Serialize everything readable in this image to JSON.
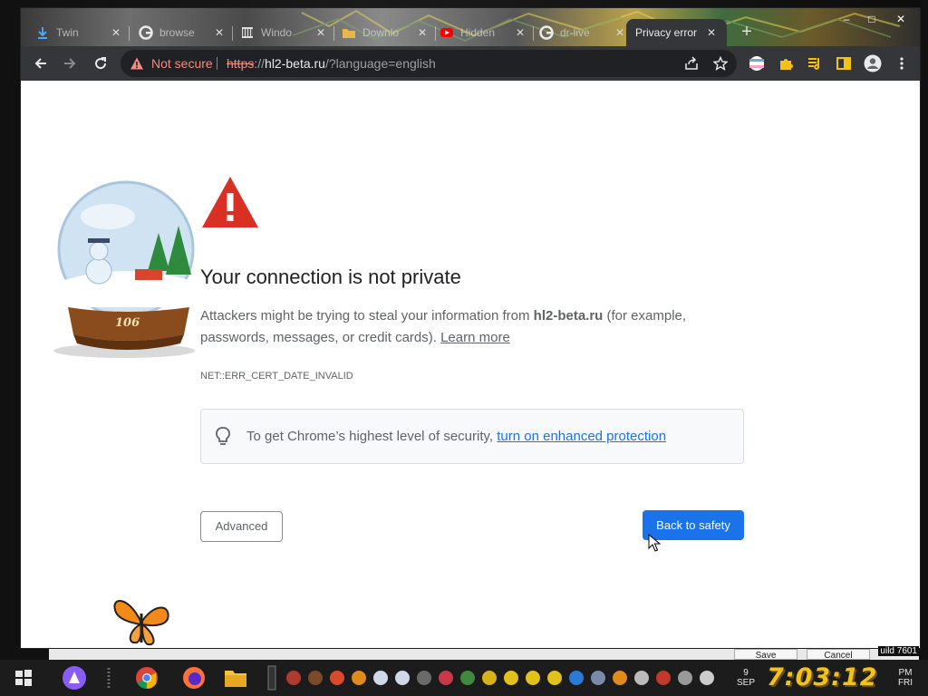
{
  "browser": {
    "tabs": [
      {
        "title": "Twin",
        "icon": "download-icon",
        "active": false
      },
      {
        "title": "browse",
        "icon": "google-icon",
        "active": false
      },
      {
        "title": "Windo",
        "icon": "archive-icon",
        "active": false
      },
      {
        "title": "Downlo",
        "icon": "folder-icon",
        "active": false
      },
      {
        "title": "Hidden",
        "icon": "youtube-icon",
        "active": false
      },
      {
        "title": "dr-live",
        "icon": "google-icon",
        "active": false
      },
      {
        "title": "Privacy error",
        "icon": "none",
        "active": true
      }
    ],
    "new_tab": "+",
    "window_controls": {
      "minimize": "–",
      "maximize": "□",
      "close": "✕"
    },
    "address": {
      "security_label": "Not secure",
      "url_scheme": "https",
      "url_sep": "://",
      "url_host": "hl2-beta.ru",
      "url_path": "/?language=english"
    }
  },
  "page": {
    "heading": "Your connection is not private",
    "message_prefix": "Attackers might be trying to steal your information from ",
    "message_host": "hl2-beta.ru",
    "message_suffix": " (for example, passwords, messages, or credit cards). ",
    "learn_more": "Learn more",
    "error_code": "NET::ERR_CERT_DATE_INVALID",
    "security_tip_prefix": "To get Chrome’s highest level of security, ",
    "security_tip_link": "turn on enhanced protection",
    "advanced_button": "Advanced",
    "back_button": "Back to safety",
    "snow_globe_label": "106"
  },
  "background_window": {
    "save": "Save",
    "cancel": "Cancel",
    "build": "uild 7601"
  },
  "taskbar": {
    "date_day": "9",
    "date_month": "SEP",
    "time": "7:03:12",
    "ampm": "PM",
    "weekday": "FRI"
  },
  "colors": {
    "warning_red": "#d93025",
    "primary_blue": "#1a73e8",
    "toolbar": "#35363a",
    "clock": "#f2c21b"
  }
}
